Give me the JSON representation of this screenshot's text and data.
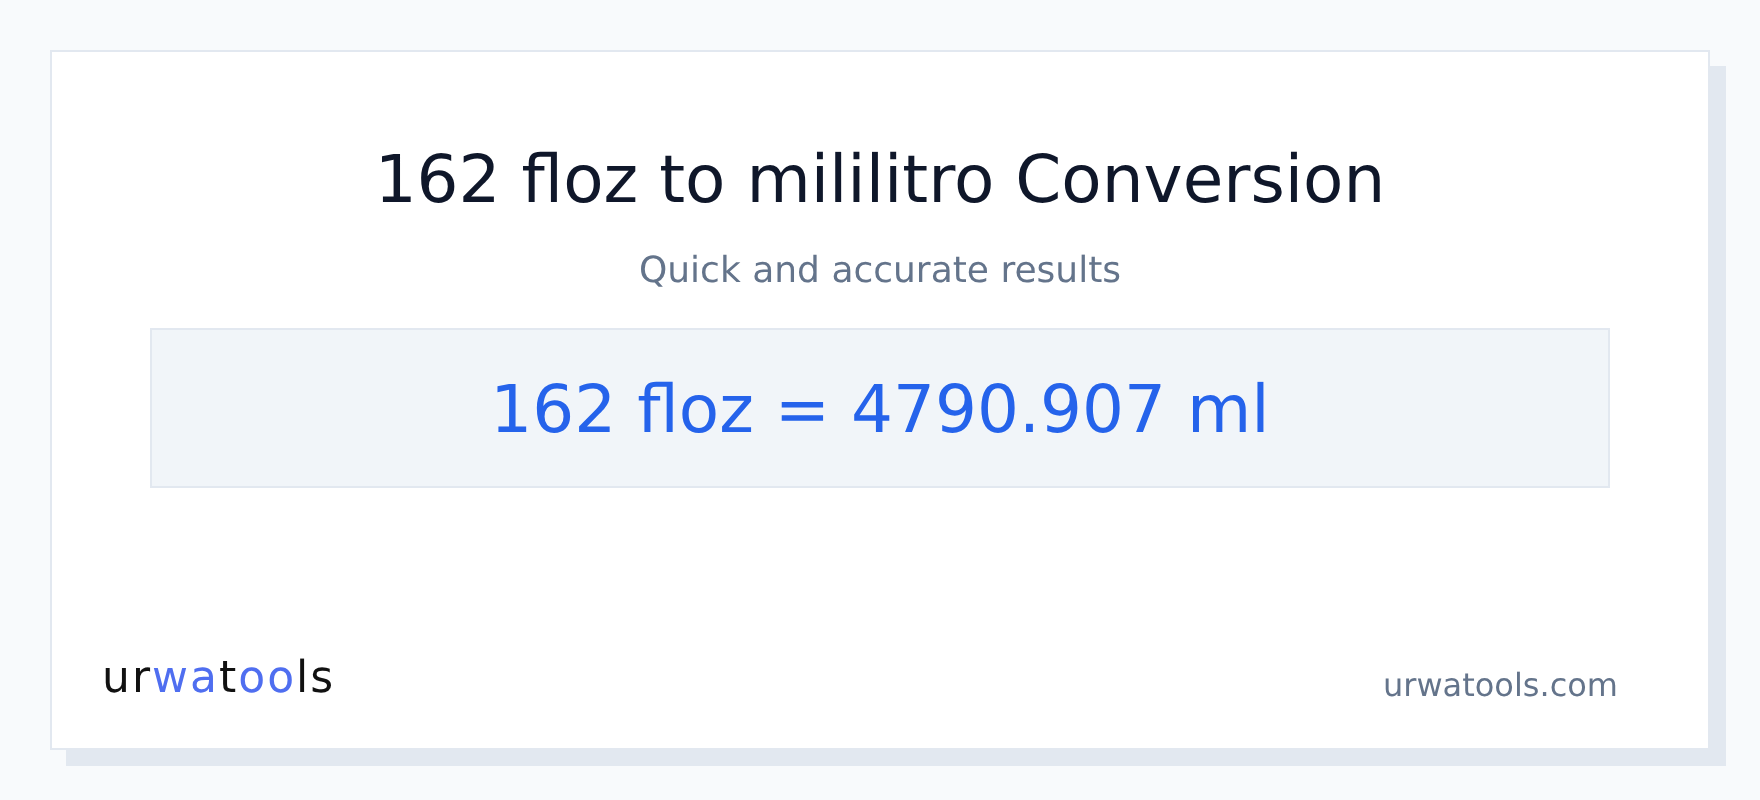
{
  "title": "162 floz to mililitro Conversion",
  "subtitle": "Quick and accurate results",
  "result": "162 floz = 4790.907 ml",
  "logo": [
    {
      "text": "ur",
      "accent": false
    },
    {
      "text": "wa",
      "accent": true
    },
    {
      "text": "t",
      "accent": false
    },
    {
      "text": "oo",
      "accent": true
    },
    {
      "text": "ls",
      "accent": false
    }
  ],
  "site": "urwatools.com"
}
